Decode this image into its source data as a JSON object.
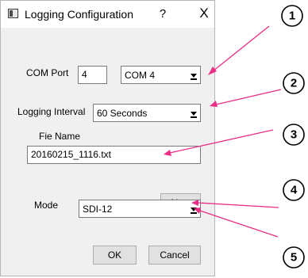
{
  "dialog": {
    "title": "Logging Configuration",
    "help_glyph": "?",
    "close_glyph": "X",
    "icon": "app-window-icon"
  },
  "com_port": {
    "label": "COM Port",
    "number_value": "4",
    "select_value": "COM 4"
  },
  "logging_interval": {
    "label": "Logging Interval",
    "select_value": "60 Seconds"
  },
  "file_name": {
    "label": "Fie Name",
    "value": "20160215_1116.txt"
  },
  "buttons": {
    "new_label": "New",
    "ok_label": "OK",
    "cancel_label": "Cancel"
  },
  "mode": {
    "label": "Mode",
    "select_value": "SDI-12"
  },
  "callouts": [
    "1",
    "2",
    "3",
    "4",
    "5"
  ],
  "colors": {
    "arrow": "#ea2e86",
    "dialog_bg": "#f0f0f0"
  }
}
